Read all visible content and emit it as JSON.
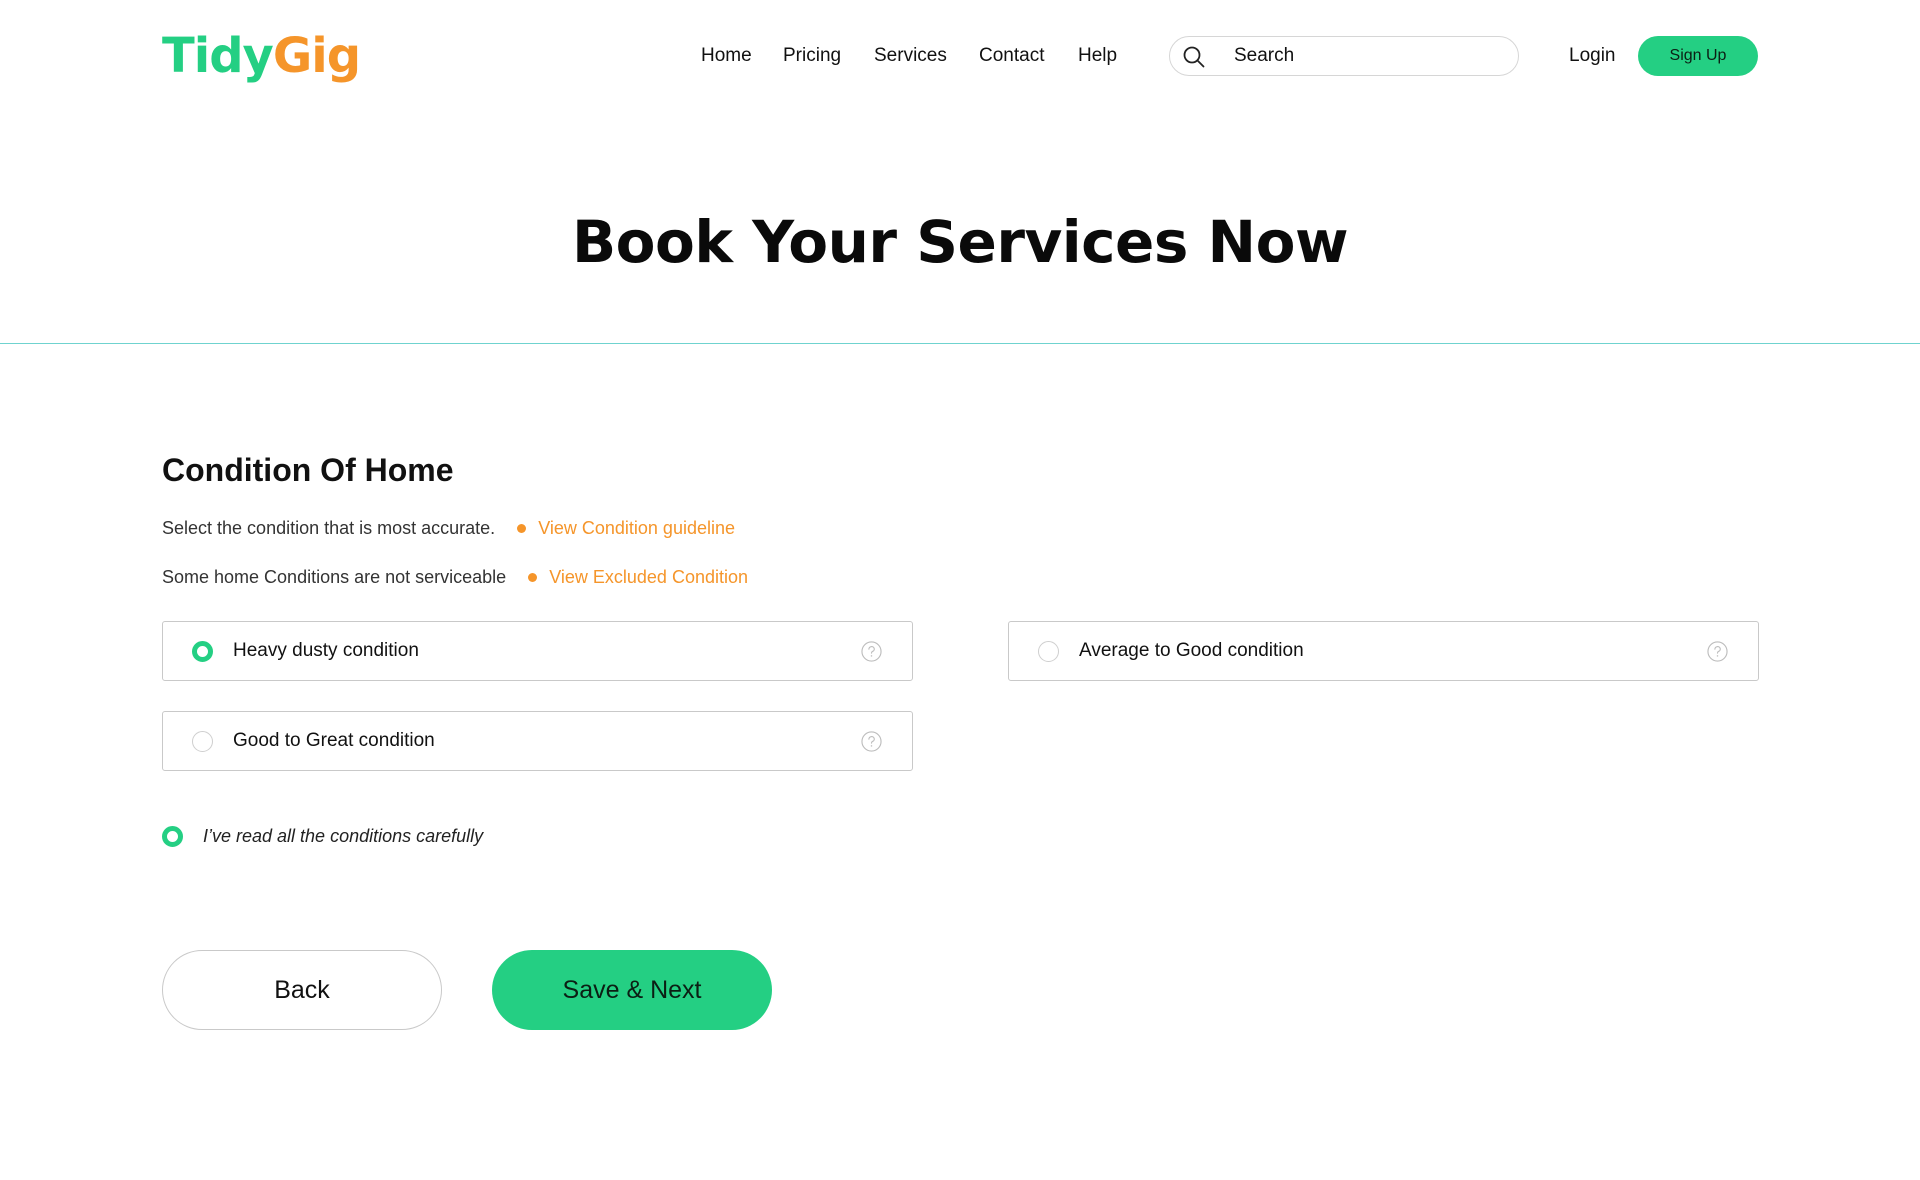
{
  "header": {
    "logo_part1": "Tidy",
    "logo_part2": "Gig",
    "nav": [
      "Home",
      "Pricing",
      "Services",
      "Contact",
      "Help"
    ],
    "search_placeholder": "Search",
    "login_label": "Login",
    "signup_label": "Sign Up"
  },
  "hero": {
    "title": "Book Your Services Now"
  },
  "condition": {
    "title": "Condition Of Home",
    "info1_text": "Select the condition that is most accurate.",
    "info1_link": "View Condition guideline",
    "info2_text": "Some home Conditions are not serviceable",
    "info2_link": "View Excluded Condition",
    "options": [
      {
        "label": "Heavy dusty condition",
        "selected": true
      },
      {
        "label": "Average to Good condition",
        "selected": false
      },
      {
        "label": "Good to Great condition",
        "selected": false
      }
    ],
    "ack_label": "I’ve read all the conditions carefully",
    "ack_checked": true
  },
  "actions": {
    "back_label": "Back",
    "next_label": "Save & Next"
  },
  "colors": {
    "accent": "#24cf83",
    "orange": "#f5952a",
    "divider": "#6fd3cf"
  },
  "icons": {
    "search": "search-icon",
    "help": "help-circle-icon"
  }
}
